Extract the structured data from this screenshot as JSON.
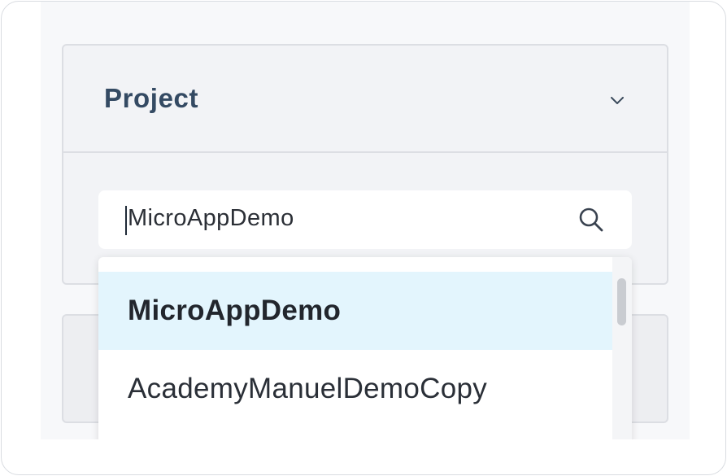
{
  "panel": {
    "title": "Project",
    "toggle_icon": "chevron-down-icon"
  },
  "search": {
    "value": "MicroAppDemo",
    "icon": "search-icon"
  },
  "dropdown": {
    "options": [
      {
        "label": "MicroAppDemo",
        "selected": true
      },
      {
        "label": "AcademyManuelDemoCopy",
        "selected": false
      }
    ]
  },
  "colors": {
    "title_text": "#344a63",
    "selected_bg": "#e3f5fd",
    "panel_bg": "#f2f3f6",
    "border": "#dcdee3"
  }
}
